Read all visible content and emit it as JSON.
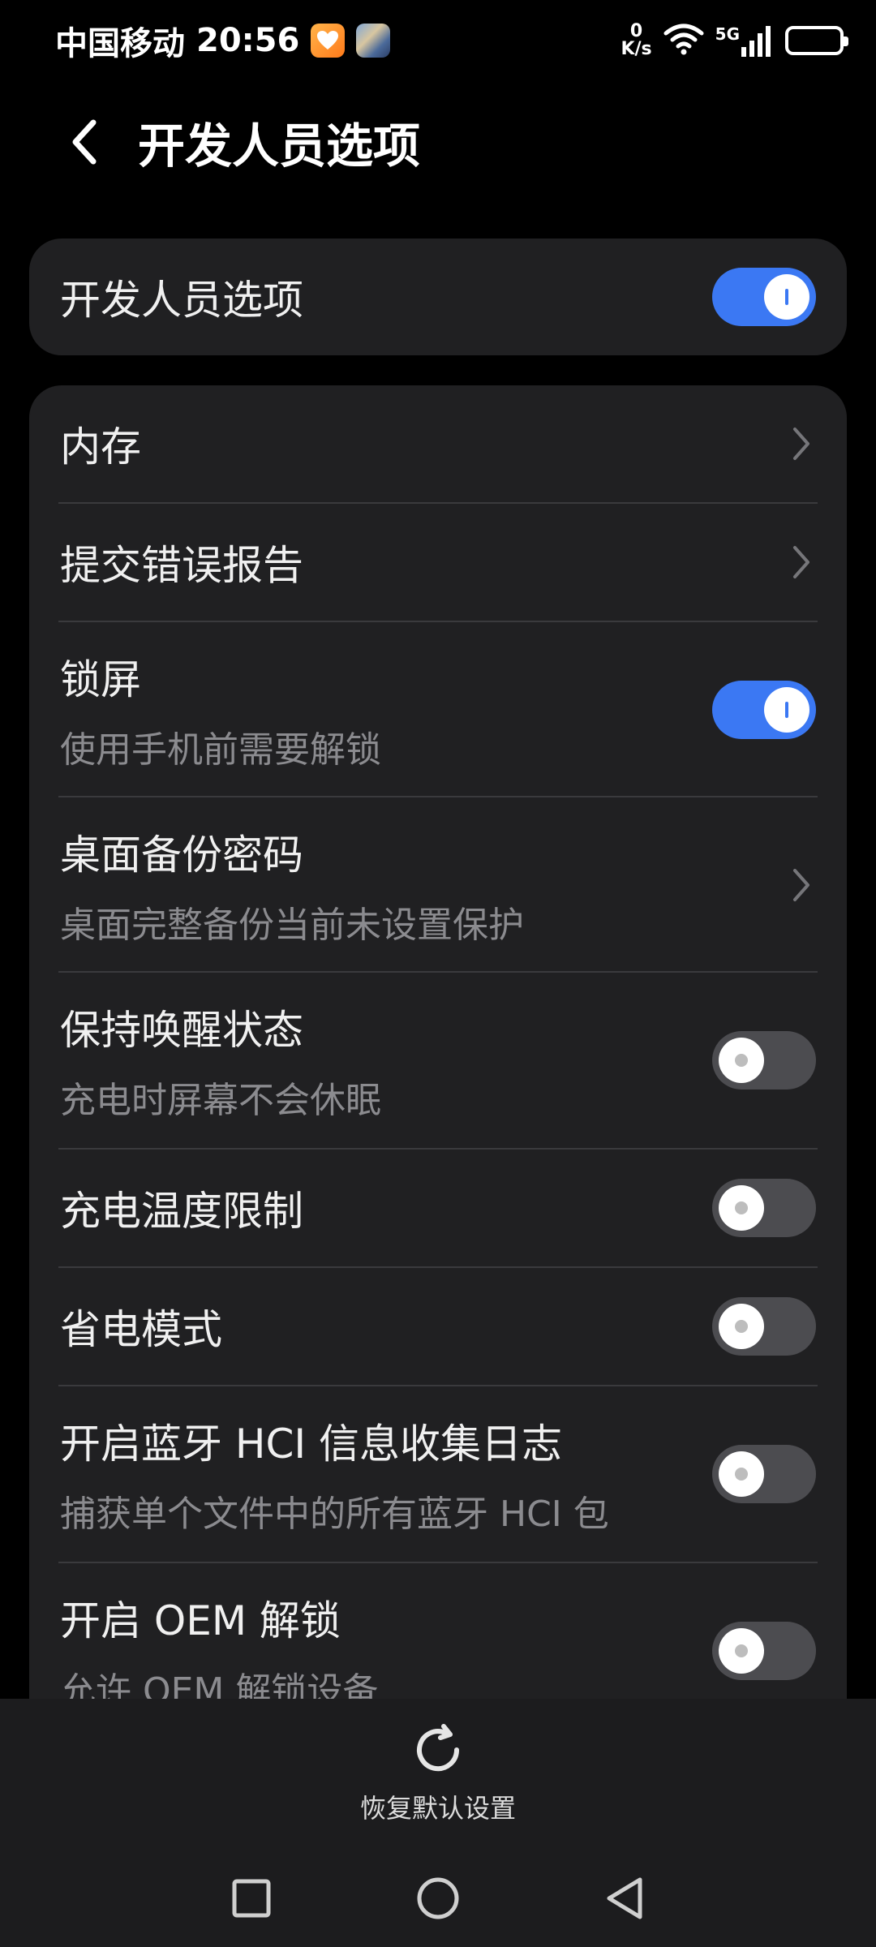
{
  "status_bar": {
    "carrier": "中国移动",
    "time": "20:56",
    "speed_value": "0",
    "speed_unit": "K/s",
    "network": "5G"
  },
  "header": {
    "title": "开发人员选项"
  },
  "master_toggle": {
    "label": "开发人员选项",
    "enabled": true
  },
  "settings": [
    {
      "label": "内存",
      "control": "chevron"
    },
    {
      "label": "提交错误报告",
      "control": "chevron"
    },
    {
      "label": "锁屏",
      "subtitle": "使用手机前需要解锁",
      "control": "toggle",
      "enabled": true
    },
    {
      "label": "桌面备份密码",
      "subtitle": "桌面完整备份当前未设置保护",
      "control": "chevron"
    },
    {
      "label": "保持唤醒状态",
      "subtitle": "充电时屏幕不会休眠",
      "control": "toggle",
      "enabled": false
    },
    {
      "label": "充电温度限制",
      "control": "toggle",
      "enabled": false
    },
    {
      "label": "省电模式",
      "control": "toggle",
      "enabled": false
    },
    {
      "label": "开启蓝牙 HCI 信息收集日志",
      "subtitle": "捕获单个文件中的所有蓝牙 HCI 包",
      "control": "toggle",
      "enabled": false
    },
    {
      "label": "开启 OEM 解锁",
      "subtitle": "允许 OEM 解锁设备",
      "control": "toggle",
      "enabled": false
    }
  ],
  "bottom_action": {
    "label": "恢复默认设置",
    "icon": "refresh-icon"
  },
  "nav": {
    "icons": [
      "recents-square-icon",
      "home-circle-icon",
      "back-triangle-icon"
    ]
  },
  "colors": {
    "accent": "#3b78f3",
    "card": "#202022",
    "background": "#000000"
  }
}
